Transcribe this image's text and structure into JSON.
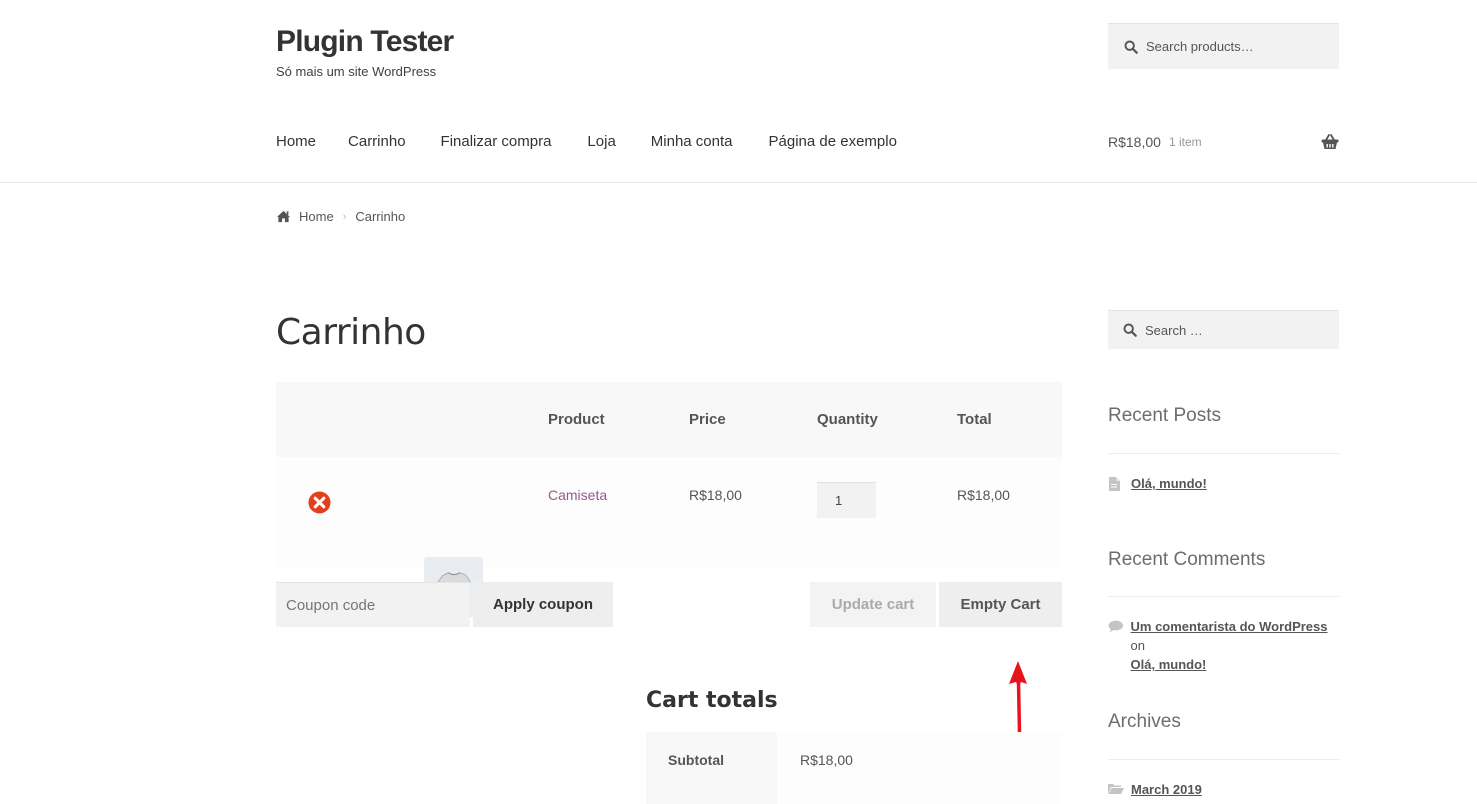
{
  "site": {
    "title": "Plugin Tester",
    "tagline": "Só mais um site WordPress"
  },
  "header_search": {
    "placeholder": "Search products…",
    "icon": "search-icon"
  },
  "nav": {
    "items": [
      {
        "label": "Home"
      },
      {
        "label": "Carrinho"
      },
      {
        "label": "Finalizar compra"
      },
      {
        "label": "Loja"
      },
      {
        "label": "Minha conta"
      },
      {
        "label": "Página de exemplo"
      }
    ]
  },
  "mini_cart": {
    "amount": "R$18,00",
    "count": "1 item",
    "icon": "basket-icon"
  },
  "breadcrumb": {
    "home": "Home",
    "current": "Carrinho",
    "icon": "home-icon"
  },
  "page": {
    "title": "Carrinho"
  },
  "cart": {
    "headers": {
      "product": "Product",
      "price": "Price",
      "quantity": "Quantity",
      "total": "Total"
    },
    "items": [
      {
        "name": "Camiseta",
        "price": "R$18,00",
        "quantity": "1",
        "total": "R$18,00",
        "thumbnail": "t-shirt-image"
      }
    ],
    "coupon_placeholder": "Coupon code",
    "apply_coupon_label": "Apply coupon",
    "update_cart_label": "Update cart",
    "empty_cart_label": "Empty Cart"
  },
  "cart_totals": {
    "title": "Cart totals",
    "subtotal_label": "Subtotal",
    "subtotal_value": "R$18,00"
  },
  "annotation": {
    "arrow_color": "#e8141b"
  },
  "sidebar": {
    "search_placeholder": "Search …",
    "recent_posts": {
      "title": "Recent Posts",
      "items": [
        {
          "label": "Olá, mundo!"
        }
      ]
    },
    "recent_comments": {
      "title": "Recent Comments",
      "items": [
        {
          "author": "Um comentarista do WordPress",
          "on": "on",
          "post": "Olá, mundo!"
        }
      ]
    },
    "archives": {
      "title": "Archives",
      "items": [
        {
          "label": "March 2019"
        }
      ]
    }
  },
  "colors": {
    "link_purple": "#96588a",
    "remove_red": "#e2401c",
    "arrow_red": "#e8141b"
  }
}
